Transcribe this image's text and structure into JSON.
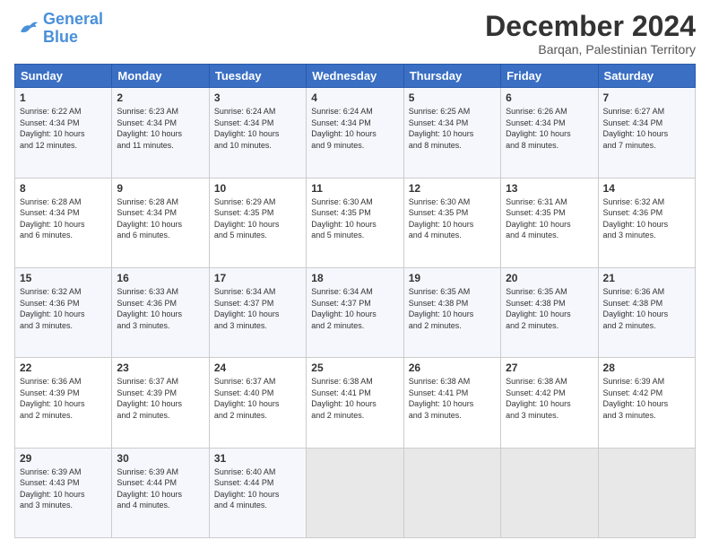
{
  "header": {
    "logo_general": "General",
    "logo_blue": "Blue",
    "month_title": "December 2024",
    "location": "Barqan, Palestinian Territory"
  },
  "days_of_week": [
    "Sunday",
    "Monday",
    "Tuesday",
    "Wednesday",
    "Thursday",
    "Friday",
    "Saturday"
  ],
  "weeks": [
    [
      {
        "day": "1",
        "info": "Sunrise: 6:22 AM\nSunset: 4:34 PM\nDaylight: 10 hours\nand 12 minutes."
      },
      {
        "day": "2",
        "info": "Sunrise: 6:23 AM\nSunset: 4:34 PM\nDaylight: 10 hours\nand 11 minutes."
      },
      {
        "day": "3",
        "info": "Sunrise: 6:24 AM\nSunset: 4:34 PM\nDaylight: 10 hours\nand 10 minutes."
      },
      {
        "day": "4",
        "info": "Sunrise: 6:24 AM\nSunset: 4:34 PM\nDaylight: 10 hours\nand 9 minutes."
      },
      {
        "day": "5",
        "info": "Sunrise: 6:25 AM\nSunset: 4:34 PM\nDaylight: 10 hours\nand 8 minutes."
      },
      {
        "day": "6",
        "info": "Sunrise: 6:26 AM\nSunset: 4:34 PM\nDaylight: 10 hours\nand 8 minutes."
      },
      {
        "day": "7",
        "info": "Sunrise: 6:27 AM\nSunset: 4:34 PM\nDaylight: 10 hours\nand 7 minutes."
      }
    ],
    [
      {
        "day": "8",
        "info": "Sunrise: 6:28 AM\nSunset: 4:34 PM\nDaylight: 10 hours\nand 6 minutes."
      },
      {
        "day": "9",
        "info": "Sunrise: 6:28 AM\nSunset: 4:34 PM\nDaylight: 10 hours\nand 6 minutes."
      },
      {
        "day": "10",
        "info": "Sunrise: 6:29 AM\nSunset: 4:35 PM\nDaylight: 10 hours\nand 5 minutes."
      },
      {
        "day": "11",
        "info": "Sunrise: 6:30 AM\nSunset: 4:35 PM\nDaylight: 10 hours\nand 5 minutes."
      },
      {
        "day": "12",
        "info": "Sunrise: 6:30 AM\nSunset: 4:35 PM\nDaylight: 10 hours\nand 4 minutes."
      },
      {
        "day": "13",
        "info": "Sunrise: 6:31 AM\nSunset: 4:35 PM\nDaylight: 10 hours\nand 4 minutes."
      },
      {
        "day": "14",
        "info": "Sunrise: 6:32 AM\nSunset: 4:36 PM\nDaylight: 10 hours\nand 3 minutes."
      }
    ],
    [
      {
        "day": "15",
        "info": "Sunrise: 6:32 AM\nSunset: 4:36 PM\nDaylight: 10 hours\nand 3 minutes."
      },
      {
        "day": "16",
        "info": "Sunrise: 6:33 AM\nSunset: 4:36 PM\nDaylight: 10 hours\nand 3 minutes."
      },
      {
        "day": "17",
        "info": "Sunrise: 6:34 AM\nSunset: 4:37 PM\nDaylight: 10 hours\nand 3 minutes."
      },
      {
        "day": "18",
        "info": "Sunrise: 6:34 AM\nSunset: 4:37 PM\nDaylight: 10 hours\nand 2 minutes."
      },
      {
        "day": "19",
        "info": "Sunrise: 6:35 AM\nSunset: 4:38 PM\nDaylight: 10 hours\nand 2 minutes."
      },
      {
        "day": "20",
        "info": "Sunrise: 6:35 AM\nSunset: 4:38 PM\nDaylight: 10 hours\nand 2 minutes."
      },
      {
        "day": "21",
        "info": "Sunrise: 6:36 AM\nSunset: 4:38 PM\nDaylight: 10 hours\nand 2 minutes."
      }
    ],
    [
      {
        "day": "22",
        "info": "Sunrise: 6:36 AM\nSunset: 4:39 PM\nDaylight: 10 hours\nand 2 minutes."
      },
      {
        "day": "23",
        "info": "Sunrise: 6:37 AM\nSunset: 4:39 PM\nDaylight: 10 hours\nand 2 minutes."
      },
      {
        "day": "24",
        "info": "Sunrise: 6:37 AM\nSunset: 4:40 PM\nDaylight: 10 hours\nand 2 minutes."
      },
      {
        "day": "25",
        "info": "Sunrise: 6:38 AM\nSunset: 4:41 PM\nDaylight: 10 hours\nand 2 minutes."
      },
      {
        "day": "26",
        "info": "Sunrise: 6:38 AM\nSunset: 4:41 PM\nDaylight: 10 hours\nand 3 minutes."
      },
      {
        "day": "27",
        "info": "Sunrise: 6:38 AM\nSunset: 4:42 PM\nDaylight: 10 hours\nand 3 minutes."
      },
      {
        "day": "28",
        "info": "Sunrise: 6:39 AM\nSunset: 4:42 PM\nDaylight: 10 hours\nand 3 minutes."
      }
    ],
    [
      {
        "day": "29",
        "info": "Sunrise: 6:39 AM\nSunset: 4:43 PM\nDaylight: 10 hours\nand 3 minutes."
      },
      {
        "day": "30",
        "info": "Sunrise: 6:39 AM\nSunset: 4:44 PM\nDaylight: 10 hours\nand 4 minutes."
      },
      {
        "day": "31",
        "info": "Sunrise: 6:40 AM\nSunset: 4:44 PM\nDaylight: 10 hours\nand 4 minutes."
      },
      {
        "day": "",
        "info": ""
      },
      {
        "day": "",
        "info": ""
      },
      {
        "day": "",
        "info": ""
      },
      {
        "day": "",
        "info": ""
      }
    ]
  ]
}
